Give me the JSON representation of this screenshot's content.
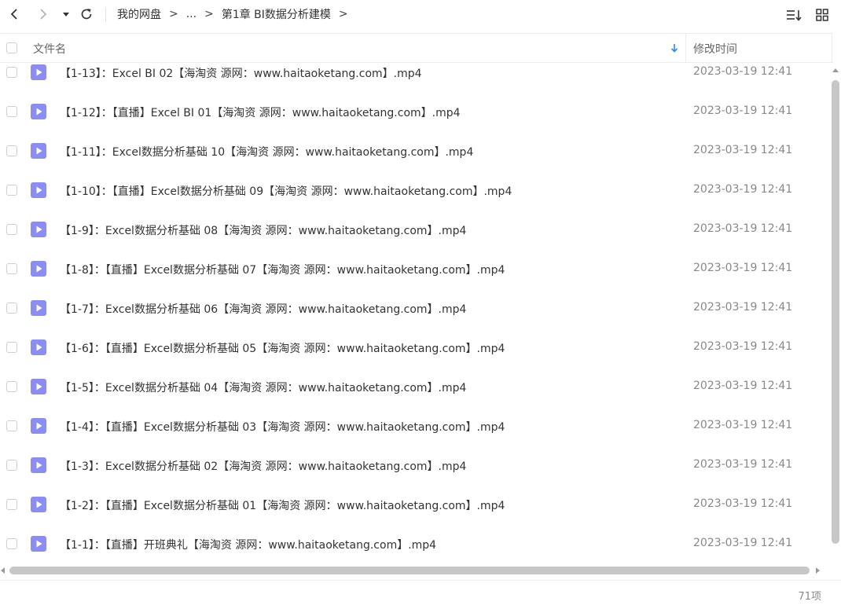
{
  "toolbar": {
    "back_icon": "chevron-left-icon",
    "forward_icon": "chevron-right-icon",
    "dropdown_icon": "caret-down-icon",
    "refresh_icon": "refresh-icon",
    "sort_icon": "sort-list-icon",
    "grid_icon": "grid-view-icon"
  },
  "breadcrumb": {
    "root": "我的网盘",
    "separator": ">",
    "ellipsis": "...",
    "current": "第1章 BI数据分析建模"
  },
  "header": {
    "name_label": "文件名",
    "time_label": "修改时间",
    "sort_direction": "descending"
  },
  "files": [
    {
      "name": "【1-13】：Excel BI 02【海淘资 源网：www.haitaoketang.com】.mp4",
      "time": "2023-03-19 12:41"
    },
    {
      "name": "【1-12】：【直播】Excel BI 01【海淘资 源网：www.haitaoketang.com】.mp4",
      "time": "2023-03-19 12:41"
    },
    {
      "name": "【1-11】：Excel数据分析基础 10【海淘资 源网：www.haitaoketang.com】.mp4",
      "time": "2023-03-19 12:41"
    },
    {
      "name": "【1-10】：【直播】Excel数据分析基础 09【海淘资 源网：www.haitaoketang.com】.mp4",
      "time": "2023-03-19 12:41"
    },
    {
      "name": "【1-9】：Excel数据分析基础 08【海淘资 源网：www.haitaoketang.com】.mp4",
      "time": "2023-03-19 12:41"
    },
    {
      "name": "【1-8】：【直播】Excel数据分析基础 07【海淘资 源网：www.haitaoketang.com】.mp4",
      "time": "2023-03-19 12:41"
    },
    {
      "name": "【1-7】：Excel数据分析基础 06【海淘资 源网：www.haitaoketang.com】.mp4",
      "time": "2023-03-19 12:41"
    },
    {
      "name": "【1-6】：【直播】Excel数据分析基础 05【海淘资 源网：www.haitaoketang.com】.mp4",
      "time": "2023-03-19 12:41"
    },
    {
      "name": "【1-5】：Excel数据分析基础 04【海淘资 源网：www.haitaoketang.com】.mp4",
      "time": "2023-03-19 12:41"
    },
    {
      "name": "【1-4】：【直播】Excel数据分析基础 03【海淘资 源网：www.haitaoketang.com】.mp4",
      "time": "2023-03-19 12:41"
    },
    {
      "name": "【1-3】：Excel数据分析基础 02【海淘资 源网：www.haitaoketang.com】.mp4",
      "time": "2023-03-19 12:41"
    },
    {
      "name": "【1-2】：【直播】Excel数据分析基础 01【海淘资 源网：www.haitaoketang.com】.mp4",
      "time": "2023-03-19 12:41"
    },
    {
      "name": "【1-1】：【直播】开班典礼【海淘资 源网：www.haitaoketang.com】.mp4",
      "time": "2023-03-19 12:41"
    }
  ],
  "file_icon": "video-file-icon",
  "status": {
    "count": "71项"
  },
  "colors": {
    "video_icon": "#8b8ef0",
    "sort_arrow": "#2e8ae6",
    "scrollbar": "#c7c7c7"
  }
}
